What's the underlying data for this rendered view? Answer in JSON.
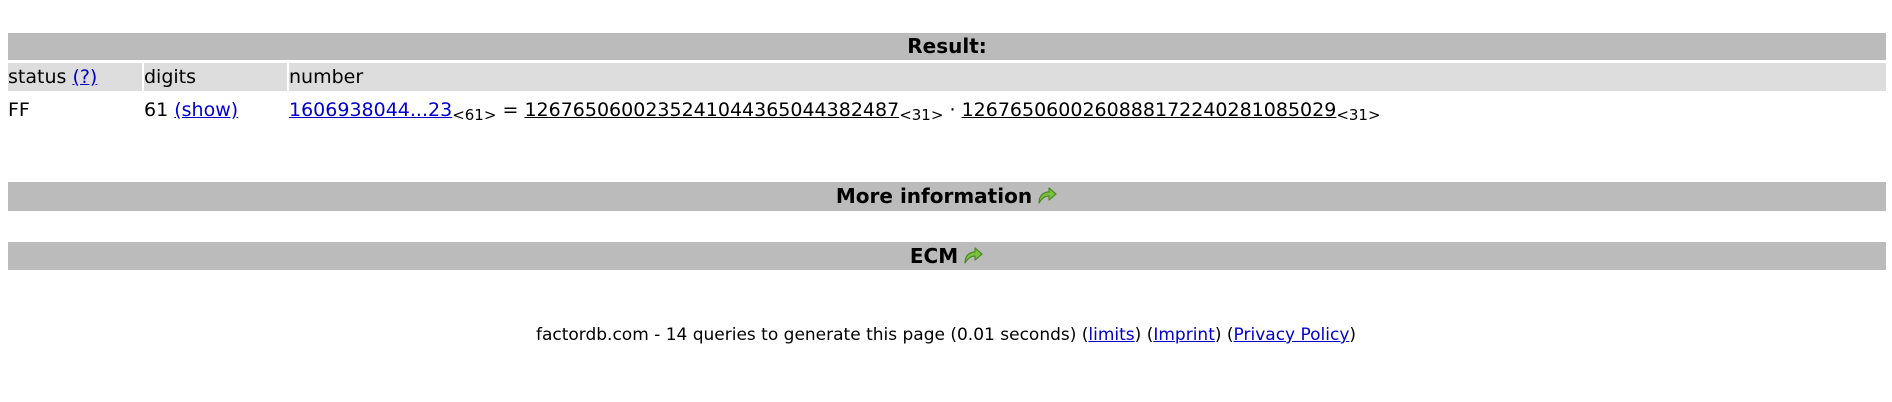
{
  "result_header": "Result:",
  "columns": {
    "status": "status",
    "status_help": "(?)",
    "digits": "digits",
    "number": "number"
  },
  "row": {
    "status": "FF",
    "digits": "61",
    "show_link": "(show)",
    "number_link": "1606938044...23",
    "number_digits": "<61>",
    "equals": "=",
    "factor1": "1267650600235241044365044382487",
    "factor1_digits": "<31>",
    "dot": "·",
    "factor2": "1267650600260888172240281085029",
    "factor2_digits": "<31>"
  },
  "sections": {
    "more_info": "More information",
    "ecm": "ECM"
  },
  "icons": {
    "more_info_icon": "green-forward-arrow-icon",
    "ecm_icon": "green-forward-arrow-icon"
  },
  "footer": {
    "text": "factordb.com - 14 queries to generate this page (0.01 seconds) (",
    "limits": "limits",
    "sep1": ") (",
    "imprint": "Imprint",
    "sep2": ") (",
    "privacy": "Privacy Policy",
    "end": ")"
  },
  "colors": {
    "bar": "#bbbbbb",
    "header_row": "#dddddd",
    "link": "#0000cc",
    "arrow": "#7ac143"
  }
}
